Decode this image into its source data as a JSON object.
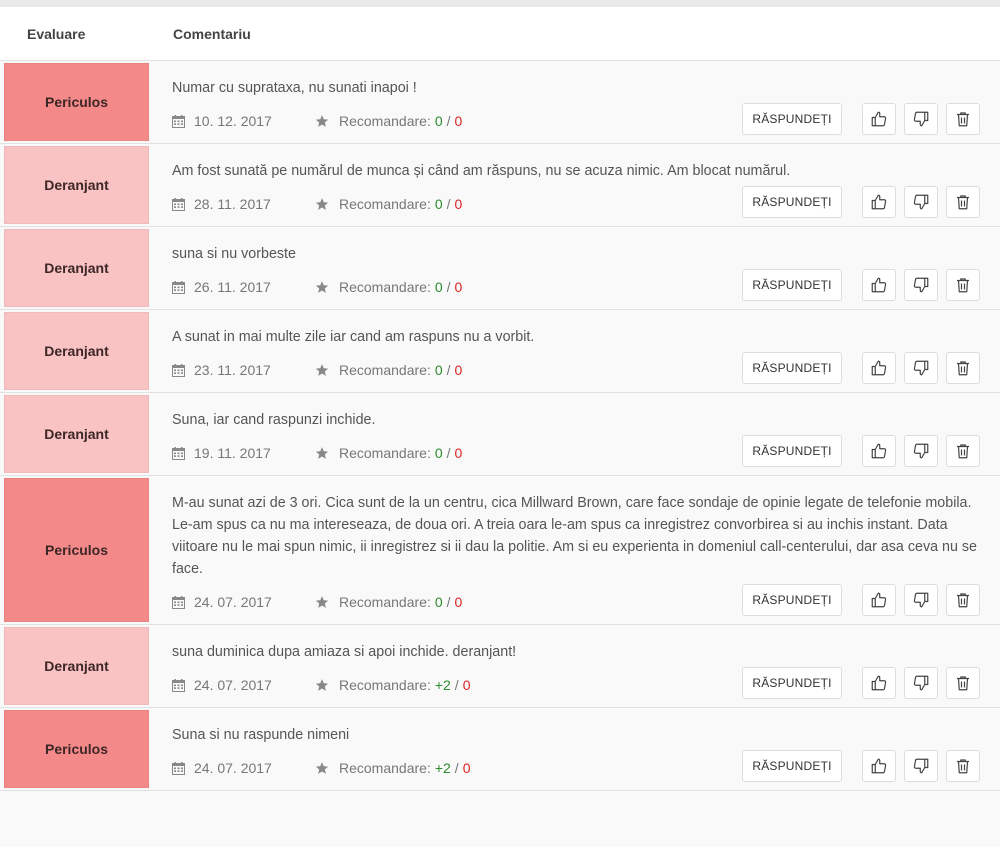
{
  "header": {
    "evaluare": "Evaluare",
    "comentariu": "Comentariu"
  },
  "labels": {
    "recommend": "Recomandare:",
    "reply": "RĂSPUNDEȚI",
    "sep": "/"
  },
  "colors": {
    "periculos": "#f38a89",
    "deranjant": "#f9c2c3",
    "positive": "#2e8b2e",
    "negative": "#dd2222"
  },
  "icons": [
    "calendar-icon",
    "star-icon",
    "thumbs-up-icon",
    "thumbs-down-icon",
    "trash-icon"
  ],
  "comments": [
    {
      "rating": "Periculos",
      "text": "Numar cu suprataxa, nu sunati inapoi !",
      "date": "10. 12. 2017",
      "pos": "0",
      "neg": "0"
    },
    {
      "rating": "Deranjant",
      "text": "Am fost sunată pe numărul de munca și când am răspuns, nu se acuza nimic. Am blocat numărul.",
      "date": "28. 11. 2017",
      "pos": "0",
      "neg": "0"
    },
    {
      "rating": "Deranjant",
      "text": "suna si nu vorbeste",
      "date": "26. 11. 2017",
      "pos": "0",
      "neg": "0"
    },
    {
      "rating": "Deranjant",
      "text": "A sunat in mai multe zile iar cand am raspuns nu a vorbit.",
      "date": "23. 11. 2017",
      "pos": "0",
      "neg": "0"
    },
    {
      "rating": "Deranjant",
      "text": "Suna, iar cand raspunzi inchide.",
      "date": "19. 11. 2017",
      "pos": "0",
      "neg": "0"
    },
    {
      "rating": "Periculos",
      "text": "M-au sunat azi de 3 ori. Cica sunt de la un centru, cica Millward Brown, care face sondaje de opinie legate de telefonie mobila. Le-am spus ca nu ma intereseaza, de doua ori. A treia oara le-am spus ca inregistrez convorbirea si au inchis instant. Data viitoare nu le mai spun nimic, ii inregistrez si ii dau la politie. Am si eu experienta in domeniul call-centerului, dar asa ceva nu se face.",
      "date": "24. 07. 2017",
      "pos": "0",
      "neg": "0"
    },
    {
      "rating": "Deranjant",
      "text": "suna duminica dupa amiaza si apoi inchide. deranjant!",
      "date": "24. 07. 2017",
      "pos": "+2",
      "neg": "0"
    },
    {
      "rating": "Periculos",
      "text": "Suna si nu raspunde nimeni",
      "date": "24. 07. 2017",
      "pos": "+2",
      "neg": "0"
    }
  ]
}
